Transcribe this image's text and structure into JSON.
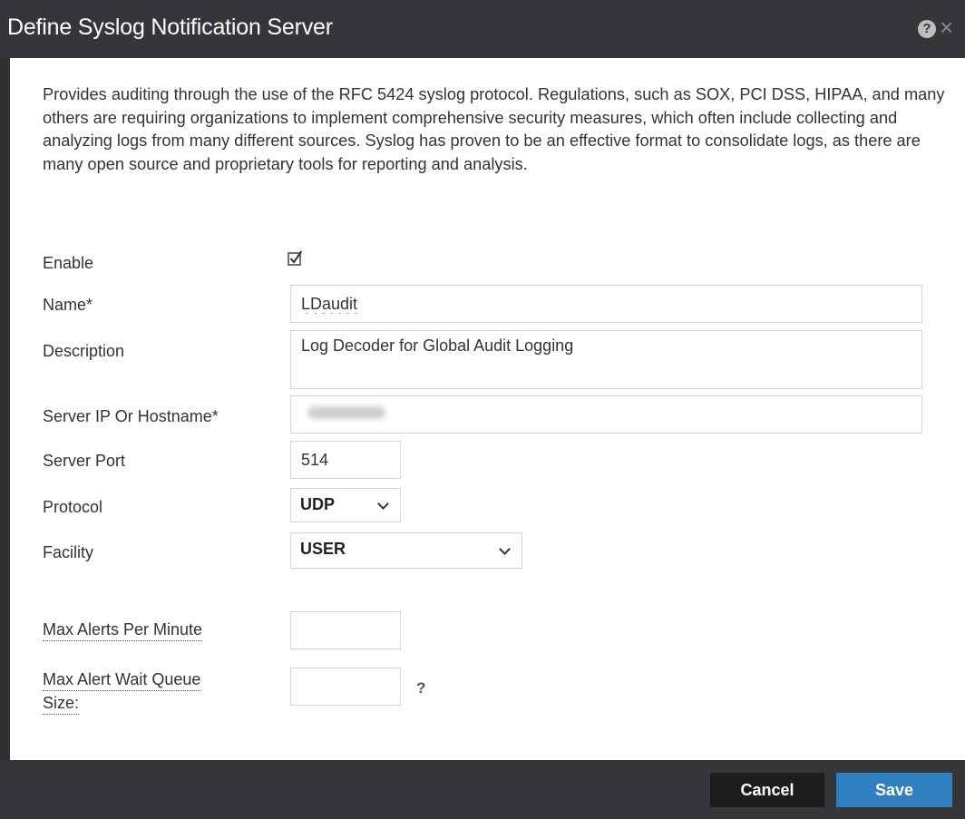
{
  "dialog": {
    "title": "Define Syslog Notification Server",
    "help_icon": "?",
    "close_icon": "×"
  },
  "intro": "Provides auditing through the use of the RFC 5424 syslog protocol. Regulations, such as SOX, PCI DSS, HIPAA, and many others are requiring organizations to implement comprehensive security measures, which often include collecting and analyzing logs from many different sources. Syslog has proven to be an effective format to consolidate logs, as there are many open source and proprietary tools for reporting and analysis.",
  "form": {
    "enable": {
      "label": "Enable",
      "checked": true
    },
    "name": {
      "label": "Name*",
      "value": "LDaudit"
    },
    "description": {
      "label": "Description",
      "value": "Log Decoder for Global Audit Logging"
    },
    "server": {
      "label": "Server IP Or Hostname*"
    },
    "port": {
      "label": "Server Port",
      "value": "514"
    },
    "protocol": {
      "label": "Protocol",
      "value": "UDP"
    },
    "facility": {
      "label": "Facility",
      "value": "USER"
    },
    "max_alerts": {
      "label": "Max Alerts Per Minute",
      "value": ""
    },
    "max_queue": {
      "label_line1": "Max Alert Wait Queue",
      "label_line2": "Size:",
      "value": "",
      "hint": "?"
    }
  },
  "buttons": {
    "cancel": "Cancel",
    "save": "Save"
  },
  "colors": {
    "save_button": "#2f7fc1",
    "cancel_button": "#1d1d1d",
    "title_bar": "#35363a"
  }
}
